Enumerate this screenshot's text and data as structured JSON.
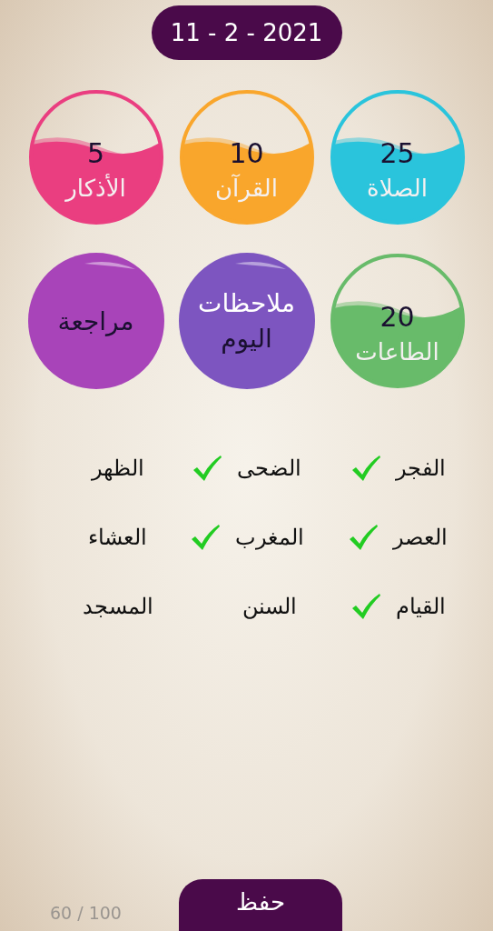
{
  "date": "11 - 2 - 2021",
  "tiles": [
    {
      "kind": "gauge",
      "value": "25",
      "label": "الصلاة",
      "color": "#2ac4dc"
    },
    {
      "kind": "gauge",
      "value": "10",
      "label": "القرآن",
      "color": "#f9a62c"
    },
    {
      "kind": "gauge",
      "value": "5",
      "label": "الأذكار",
      "color": "#ea3e80"
    },
    {
      "kind": "gauge",
      "value": "20",
      "label": "الطاعات",
      "color": "#68bb6a"
    },
    {
      "kind": "button",
      "color": "#7d55c0",
      "lines": [
        {
          "text": "ملاحظات",
          "color": "#ffffff"
        },
        {
          "text": "اليوم",
          "color": "#1a1030"
        }
      ]
    },
    {
      "kind": "button",
      "color": "#a844b9",
      "lines": [
        {
          "text": "مراجعة",
          "color": "#1a1030"
        }
      ]
    }
  ],
  "checklist": [
    {
      "label": "الفجر",
      "checked": true
    },
    {
      "label": "الضحى",
      "checked": true
    },
    {
      "label": "الظهر",
      "checked": false
    },
    {
      "label": "العصر",
      "checked": true
    },
    {
      "label": "المغرب",
      "checked": true
    },
    {
      "label": "العشاء",
      "checked": false
    },
    {
      "label": "القيام",
      "checked": true
    },
    {
      "label": "السنن",
      "checked": false
    },
    {
      "label": "المسجد",
      "checked": false
    }
  ],
  "counter": "60 / 100",
  "save_button": "حفظ"
}
